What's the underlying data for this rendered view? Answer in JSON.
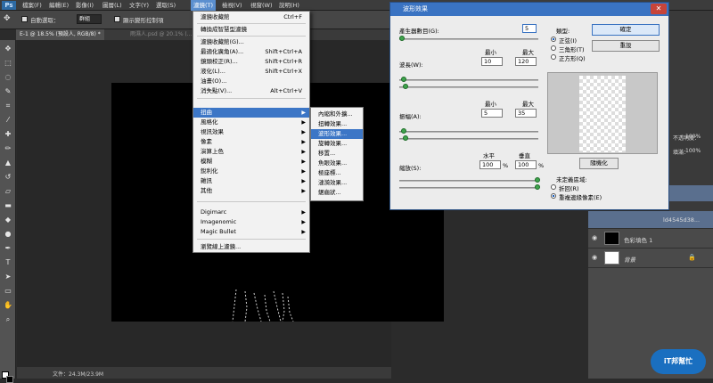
{
  "app": {
    "logo": "Ps"
  },
  "menubar": {
    "items": [
      "檔案(F)",
      "編輯(E)",
      "影像(I)",
      "圖層(L)",
      "文字(Y)",
      "選取(S)",
      "濾鏡(T)",
      "檢視(V)",
      "視窗(W)",
      "說明(H)"
    ],
    "active_index": 6
  },
  "options": {
    "auto_select_label": "自動選取：",
    "auto_select_value": "群組",
    "show_transform_label": "顯示變形控制項"
  },
  "tabs": [
    {
      "label": "E-1 @ 18.5% (預設人, RGB/8) *"
    },
    {
      "label": "雨濕人.psd @ 20.1% (..."
    }
  ],
  "status": {
    "doc_size": "文件：24.3M/23.9M"
  },
  "filter_menu": {
    "items": [
      {
        "label": "濾鏡收藏館",
        "shortcut": "Ctrl+F"
      },
      {
        "label": "轉換成智慧型濾鏡",
        "shortcut": ""
      },
      {
        "label": "濾鏡收藏館(G)...",
        "shortcut": ""
      },
      {
        "label": "最適化廣角(A)...",
        "shortcut": "Shift+Ctrl+A"
      },
      {
        "label": "鏡頭校正(R)...",
        "shortcut": "Shift+Ctrl+R"
      },
      {
        "label": "液化(L)...",
        "shortcut": "Shift+Ctrl+X"
      },
      {
        "label": "油畫(O)...",
        "shortcut": ""
      },
      {
        "label": "消失點(V)...",
        "shortcut": "Alt+Ctrl+V"
      }
    ],
    "groups": [
      "扭曲",
      "風格化",
      "視訊效果",
      "像素",
      "演算上色",
      "模糊",
      "銳利化",
      "雜訊",
      "其他"
    ],
    "plugins": [
      "Digimarc",
      "Imagenomic",
      "Magic Bullet"
    ],
    "browse": "瀏覽線上濾鏡..."
  },
  "distort_submenu": {
    "items": [
      "內縮和外擴...",
      "扭轉效果...",
      "波形效果...",
      "旋轉效果...",
      "移置...",
      "魚眼效果...",
      "極座標...",
      "漣漪效果...",
      "鋸齒狀..."
    ],
    "highlight_index": 2
  },
  "wave_dialog": {
    "title": "波形效果",
    "generators_label": "產生器數目(G):",
    "generators_value": "5",
    "min_label": "最小",
    "max_label": "最大",
    "wavelength_label": "波長(W):",
    "wavelength_min": "10",
    "wavelength_max": "120",
    "amplitude_label": "振幅(A):",
    "amplitude_min": "5",
    "amplitude_max": "35",
    "horizontal_label": "水平",
    "vertical_label": "垂直",
    "scale_label": "縮放(S):",
    "scale_h": "100",
    "scale_v": "100",
    "percent": "%",
    "type_label": "類型:",
    "type_options": [
      "正弦(I)",
      "三角形(T)",
      "正方形(Q)"
    ],
    "type_selected": 0,
    "ok_button": "確定",
    "reset_button": "重設",
    "randomize_button": "隨機化",
    "undefined_label": "未定義區域:",
    "undefined_options": [
      "折回(R)",
      "重複邊緣像素(E)"
    ],
    "undefined_selected": 1
  },
  "layers": {
    "opacity_label": "不透明度：",
    "opacity_value": "100%",
    "fill_label": "填滿：",
    "fill_value": "100%",
    "rows": [
      {
        "name": "ld4545d38..."
      },
      {
        "name": "色彩填色 1"
      },
      {
        "name": "背景"
      }
    ]
  },
  "watermark": {
    "text": "iT邦幫忙"
  },
  "colors": {
    "accent": "#3c76c6",
    "title_bar": "#3a73c2",
    "close": "#c7443a"
  }
}
